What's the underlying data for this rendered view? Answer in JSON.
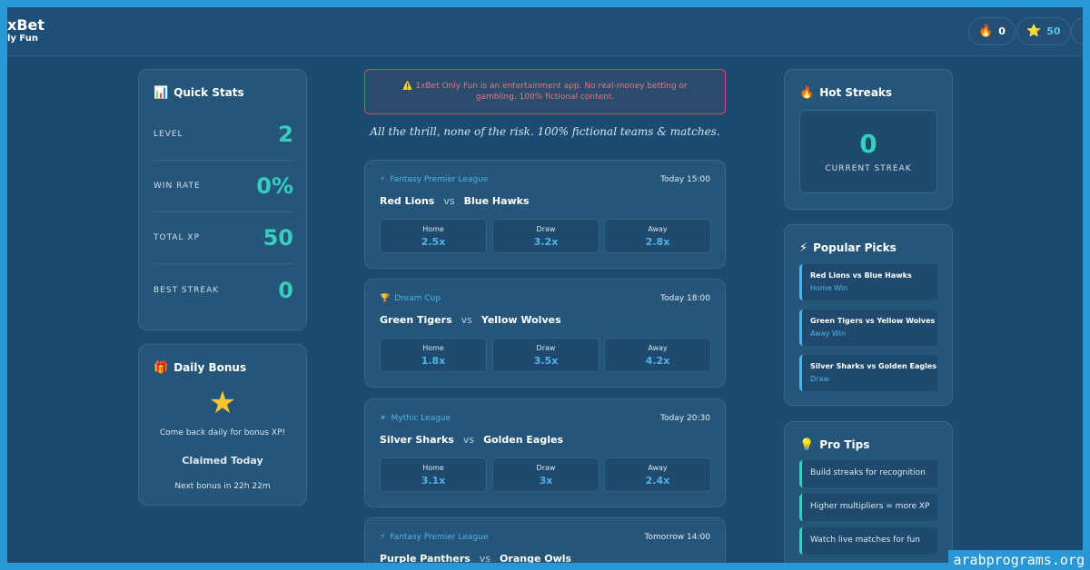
{
  "brand": {
    "line1": "xBet",
    "line2": "ly Fun"
  },
  "header": {
    "fire_count": "0",
    "star_count": "50"
  },
  "quick_stats": {
    "title": "Quick Stats",
    "rows": [
      {
        "label": "LEVEL",
        "value": "2"
      },
      {
        "label": "WIN RATE",
        "value": "0%"
      },
      {
        "label": "TOTAL XP",
        "value": "50"
      },
      {
        "label": "BEST STREAK",
        "value": "0"
      }
    ]
  },
  "daily_bonus": {
    "title": "Daily Bonus",
    "message": "Come back daily for bonus XP!",
    "status": "Claimed Today",
    "next": "Next bonus in 22h 22m"
  },
  "alert": "1xBet Only Fun is an entertainment app. No real-money betting or gambling. 100% fictional content.",
  "tagline": "All the thrill, none of the risk. 100% fictional teams & matches.",
  "matches": [
    {
      "league": "Fantasy Premier League",
      "time": "Today 15:00",
      "home": "Red Lions",
      "vs": "vs",
      "away": "Blue Hawks",
      "odds": [
        {
          "label": "Home",
          "value": "2.5x"
        },
        {
          "label": "Draw",
          "value": "3.2x"
        },
        {
          "label": "Away",
          "value": "2.8x"
        }
      ]
    },
    {
      "league": "Dream Cup",
      "time": "Today 18:00",
      "home": "Green Tigers",
      "vs": "vs",
      "away": "Yellow Wolves",
      "odds": [
        {
          "label": "Home",
          "value": "1.8x"
        },
        {
          "label": "Draw",
          "value": "3.5x"
        },
        {
          "label": "Away",
          "value": "4.2x"
        }
      ]
    },
    {
      "league": "Mythic League",
      "time": "Today 20:30",
      "home": "Silver Sharks",
      "vs": "vs",
      "away": "Golden Eagles",
      "odds": [
        {
          "label": "Home",
          "value": "3.1x"
        },
        {
          "label": "Draw",
          "value": "3x"
        },
        {
          "label": "Away",
          "value": "2.4x"
        }
      ]
    },
    {
      "league": "Fantasy Premier League",
      "time": "Tomorrow 14:00",
      "home": "Purple Panthers",
      "vs": "vs",
      "away": "Orange Owls"
    }
  ],
  "hot_streaks": {
    "title": "Hot Streaks",
    "value": "0",
    "label": "CURRENT STREAK"
  },
  "popular_picks": {
    "title": "Popular Picks",
    "items": [
      {
        "match": "Red Lions vs Blue Hawks",
        "pick": "Home Win"
      },
      {
        "match": "Green Tigers vs Yellow Wolves",
        "pick": "Away Win"
      },
      {
        "match": "Silver Sharks vs Golden Eagles",
        "pick": "Draw"
      }
    ]
  },
  "pro_tips": {
    "title": "Pro Tips",
    "items": [
      "Build streaks for recognition",
      "Higher multipliers = more XP",
      "Watch live matches for fun"
    ]
  },
  "watermark": "arabprograms.org",
  "colors": {
    "accent_teal": "#34d0bd",
    "accent_blue": "#4fb3ea",
    "alert_red": "#c84f5c",
    "card_bg": "#255579"
  },
  "icons": {
    "fire": "fire-icon",
    "star": "star-icon",
    "stats": "bar-chart-icon",
    "gift": "gift-icon",
    "lightning": "lightning-icon",
    "trophy": "trophy-icon",
    "bulb": "lightbulb-icon",
    "warning": "warning-icon"
  }
}
